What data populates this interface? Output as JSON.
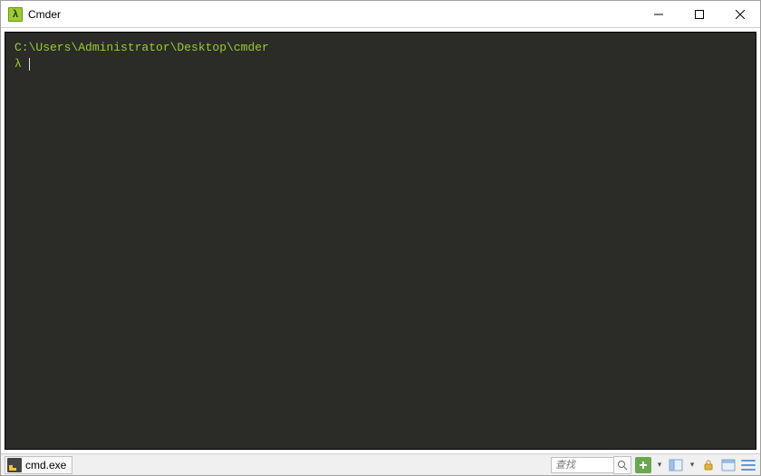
{
  "window": {
    "title": "Cmder",
    "app_icon_glyph": "λ"
  },
  "terminal": {
    "cwd": "C:\\Users\\Administrator\\Desktop\\cmder",
    "prompt": "λ",
    "input_value": ""
  },
  "statusbar": {
    "tab_label": "cmd.exe",
    "search_placeholder": "查找"
  }
}
